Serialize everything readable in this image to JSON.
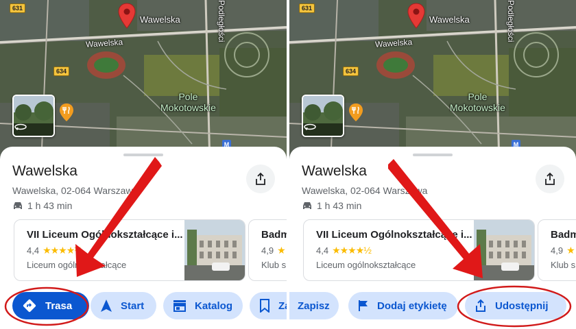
{
  "map": {
    "street_main": "Wawelska",
    "street_side": "Wawelska",
    "street_vertical": "Podległości",
    "park_name": "Pole\nMokotowskie",
    "route_shields": [
      "631",
      "634"
    ],
    "metro_label": "M"
  },
  "place": {
    "title": "Wawelska",
    "address": "Wawelska, 02-064 Warszawa",
    "duration": "1 h 43 min"
  },
  "cards": [
    {
      "name": "VII Liceum Ogólnokształcące i...",
      "rating": "4,4",
      "stars": "★★★★½",
      "type": "Liceum ogólnokształcące"
    },
    {
      "name": "Badm",
      "rating": "4,9",
      "type": "Klub sp"
    }
  ],
  "left_actions": [
    {
      "label": "Trasa",
      "icon": "directions-icon"
    },
    {
      "label": "Start",
      "icon": "navigation-arrow-icon"
    },
    {
      "label": "Katalog",
      "icon": "storefront-icon"
    },
    {
      "label": "Zapisz",
      "icon": "bookmark-icon"
    }
  ],
  "right_actions": [
    {
      "label": "Zapisz",
      "icon": "bookmark-icon"
    },
    {
      "label": "Dodaj etykietę",
      "icon": "flag-icon"
    },
    {
      "label": "Udostępnij",
      "icon": "share-icon"
    }
  ],
  "colors": {
    "primary": "#0b57d0",
    "chip_bg": "#d3e3fd",
    "annotation_red": "#e01818",
    "star": "#fbbc04",
    "pin": "#e53935"
  }
}
